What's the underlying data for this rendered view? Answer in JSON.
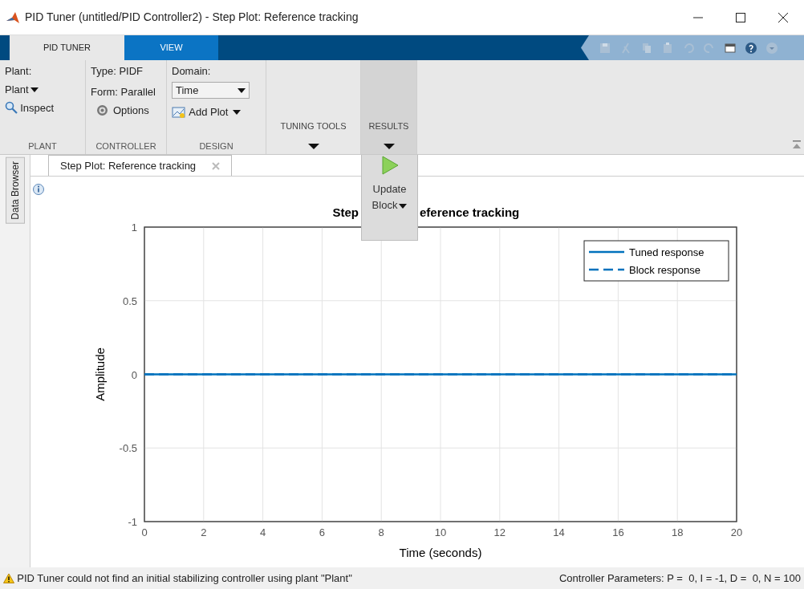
{
  "window": {
    "title": "PID Tuner (untitled/PID Controller2) - Step Plot: Reference tracking"
  },
  "tabs": [
    {
      "label": "PID TUNER",
      "selected": true
    },
    {
      "label": "VIEW",
      "selected": false
    }
  ],
  "ribbon": {
    "plant": {
      "label": "Plant:",
      "dropdown": "Plant",
      "button": "Inspect",
      "footer": "PLANT"
    },
    "controller": {
      "type": "Type: PIDF",
      "form": "Form: Parallel",
      "button": "Options",
      "footer": "CONTROLLER"
    },
    "design": {
      "label": "Domain:",
      "select_value": "Time",
      "button": "Add Plot",
      "footer": "DESIGN"
    },
    "tuning_tools": {
      "label": "TUNING TOOLS"
    },
    "results": {
      "label": "RESULTS",
      "expanded": true,
      "menu": [
        {
          "label": "Update Block"
        }
      ]
    }
  },
  "side_tab": "Data Browser",
  "document_tabs": [
    {
      "label": "Step Plot: Reference tracking",
      "selected": true
    }
  ],
  "plot": {
    "title_visible": [
      "Step",
      "eference tracking"
    ],
    "chart_data": {
      "type": "line",
      "xlabel": "Time (seconds)",
      "ylabel": "Amplitude",
      "x": [
        0,
        20
      ],
      "series": [
        {
          "name": "Tuned response",
          "color": "#0072bd",
          "line_style": "solid",
          "values": [
            0,
            0
          ]
        },
        {
          "name": "Block response",
          "color": "#0072bd",
          "line_style": "dashed",
          "values": [
            0,
            0
          ]
        }
      ],
      "grid": true,
      "legend": true,
      "xlim": [
        0,
        20
      ],
      "ylim": [
        -1,
        1
      ],
      "xticks": [
        0,
        2,
        4,
        6,
        8,
        10,
        12,
        14,
        16,
        18,
        20
      ],
      "yticks": [
        -1,
        -0.5,
        0,
        0.5,
        1
      ]
    }
  },
  "status_bar": {
    "message": "PID Tuner could not find an initial stabilizing controller using plant \"Plant\"",
    "parameters": "Controller Parameters: P =  0, I = -1, D =  0, N = 100"
  }
}
